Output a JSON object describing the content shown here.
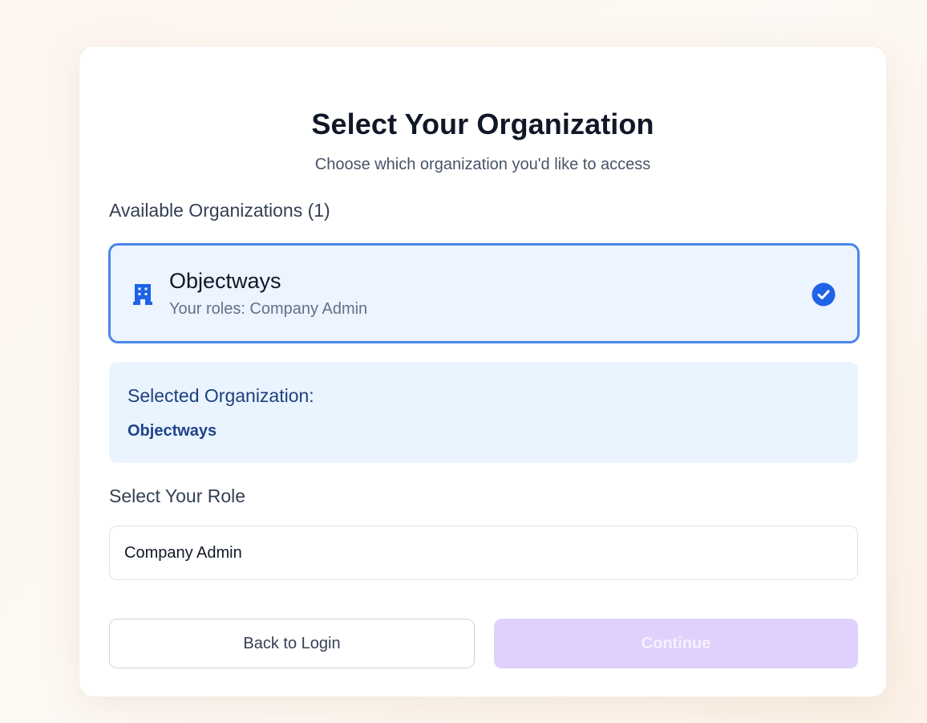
{
  "header": {
    "title": "Select Your Organization",
    "subtitle": "Choose which organization you'd like to access"
  },
  "organizations": {
    "label": "Available Organizations (1)",
    "items": [
      {
        "name": "Objectways",
        "roles": "Your roles: Company Admin",
        "icon": "building-icon",
        "selected": true
      }
    ]
  },
  "selection": {
    "label": "Selected Organization:",
    "value": "Objectways"
  },
  "role": {
    "label": "Select Your Role",
    "value": "Company Admin"
  },
  "actions": {
    "back_label": "Back to Login",
    "continue_label": "Continue"
  },
  "colors": {
    "accent": "#4a86e8",
    "check": "#1f63e6",
    "selected_bg": "#ebf4ff",
    "continue_disabled": "#dfd1fb"
  }
}
